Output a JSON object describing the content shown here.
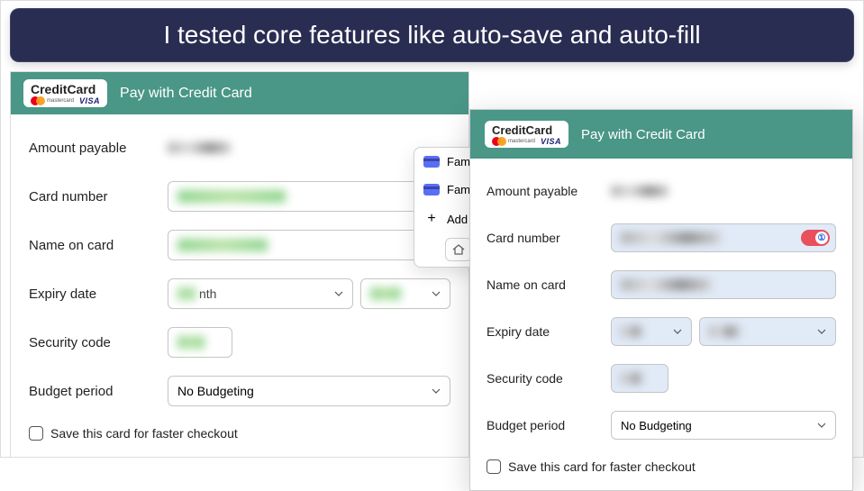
{
  "banner": {
    "text": "I tested core features like auto-save and auto-fill"
  },
  "colors": {
    "banner_bg": "#2a2d52",
    "header_bg": "#4a9687",
    "autofill_blue": "#e1eaf7"
  },
  "left": {
    "logo_title": "CreditCard",
    "logo_mc": "mastercard",
    "logo_visa": "VISA",
    "header_title": "Pay with Credit Card",
    "labels": {
      "amount": "Amount payable",
      "card": "Card number",
      "name": "Name on card",
      "expiry": "Expiry date",
      "cvv": "Security code",
      "budget": "Budget period"
    },
    "expiry_month_placeholder": "nth",
    "budget_value": "No Budgeting",
    "save_card": "Save this card for faster checkout"
  },
  "autofill": {
    "item1": "Family",
    "item2": "Family",
    "add": "Add Cr",
    "home_icon": "home-icon"
  },
  "right": {
    "logo_title": "CreditCard",
    "logo_mc": "mastercard",
    "logo_visa": "VISA",
    "header_title": "Pay with Credit Card",
    "labels": {
      "amount": "Amount payable",
      "card": "Card number",
      "name": "Name on card",
      "expiry": "Expiry date",
      "cvv": "Security code",
      "budget": "Budget period"
    },
    "budget_value": "No Budgeting",
    "save_card": "Save this card for faster checkout"
  }
}
